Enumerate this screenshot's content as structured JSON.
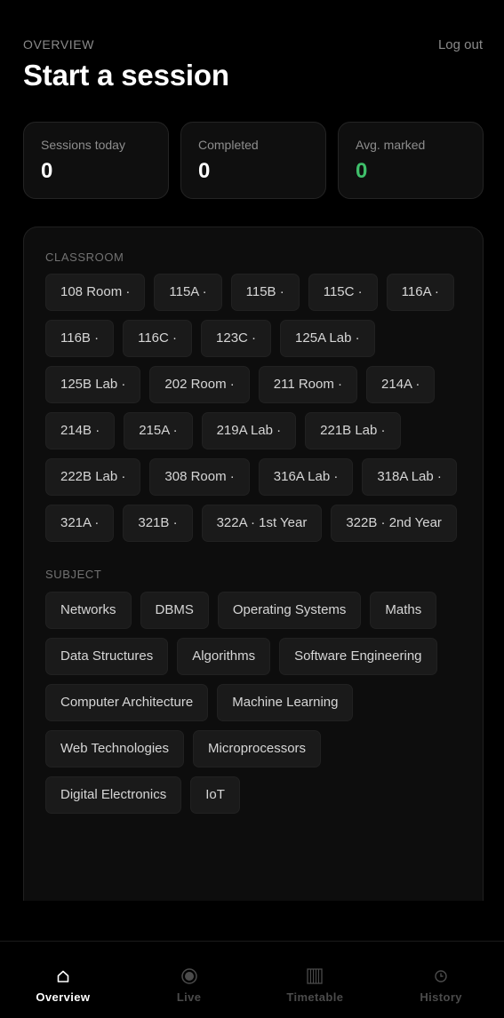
{
  "header": {
    "eyebrow": "OVERVIEW",
    "title": "Start a session",
    "logout_label": "Log out"
  },
  "stats": [
    {
      "label": "Sessions today",
      "value": "0"
    },
    {
      "label": "Completed",
      "value": "0"
    },
    {
      "label": "Avg. marked",
      "value": "0",
      "value_color": "#3fbf6a"
    }
  ],
  "classroom": {
    "label": "CLASSROOM",
    "chips": [
      "108 Room ·",
      "115A ·",
      "115B ·",
      "115C ·",
      "116A ·",
      "116B ·",
      "116C ·",
      "123C ·",
      "125A Lab ·",
      "125B Lab ·",
      "202 Room ·",
      "211 Room ·",
      "214A ·",
      "214B ·",
      "215A ·",
      "219A Lab ·",
      "221B Lab ·",
      "222B Lab ·",
      "308 Room ·",
      "316A Lab ·",
      "318A Lab ·",
      "321A ·",
      "321B ·",
      "322A · 1st Year",
      "322B · 2nd Year"
    ]
  },
  "subject": {
    "label": "SUBJECT",
    "chips": [
      "Networks",
      "DBMS",
      "Operating Systems",
      "Maths",
      "Data Structures",
      "Algorithms",
      "Software Engineering",
      "Computer Architecture",
      "Machine Learning",
      "Web Technologies",
      "Microprocessors",
      "Digital Electronics",
      "IoT"
    ]
  },
  "tabbar": {
    "active": "overview",
    "tabs": [
      {
        "id": "overview",
        "label": "Overview",
        "icon": "home-icon"
      },
      {
        "id": "live",
        "label": "Live",
        "icon": "record-icon"
      },
      {
        "id": "timetable",
        "label": "Timetable",
        "icon": "grid-icon"
      },
      {
        "id": "history",
        "label": "History",
        "icon": "clock-icon"
      }
    ]
  }
}
